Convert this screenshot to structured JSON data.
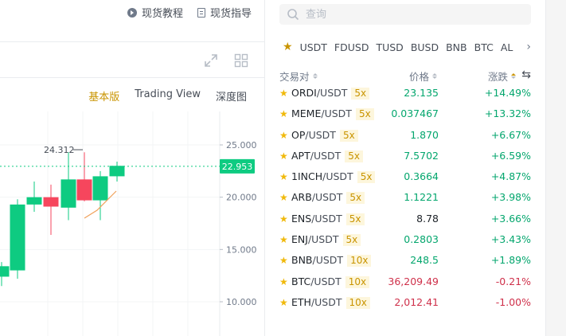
{
  "header": {
    "links": [
      {
        "label": "现货教程",
        "icon": "play-circle-icon"
      },
      {
        "label": "现货指导",
        "icon": "book-icon"
      }
    ]
  },
  "chart_toolbar": {
    "tabs": [
      {
        "label": "基本版",
        "active": true
      },
      {
        "label": "Trading View",
        "active": false
      },
      {
        "label": "深度图",
        "active": false
      }
    ]
  },
  "chart_data": {
    "type": "candlestick",
    "y_ticks": [
      "25.000",
      "20.000",
      "15.000",
      "10.000"
    ],
    "y_tick_values": [
      25,
      20,
      15,
      10
    ],
    "current_price": "22.953",
    "high_annotation": "24.312",
    "candles": [
      {
        "open": 12.4,
        "high": 13.8,
        "low": 11.5,
        "close": 13.4
      },
      {
        "open": 13.0,
        "high": 19.8,
        "low": 12.2,
        "close": 19.3
      },
      {
        "open": 19.3,
        "high": 21.5,
        "low": 18.6,
        "close": 20.0
      },
      {
        "open": 20.0,
        "high": 21.2,
        "low": 16.4,
        "close": 19.1
      },
      {
        "open": 19.0,
        "high": 24.3,
        "low": 17.8,
        "close": 21.7
      },
      {
        "open": 21.7,
        "high": 24.3,
        "low": 19.6,
        "close": 19.7
      },
      {
        "open": 19.7,
        "high": 22.5,
        "low": 17.8,
        "close": 22.0
      },
      {
        "open": 22.0,
        "high": 23.4,
        "low": 21.5,
        "close": 23.0
      }
    ],
    "colors": {
      "up": "#0ecb81",
      "down": "#f6465d",
      "price_tag": "#0ecb81",
      "ma": "#f0a15a"
    }
  },
  "search": {
    "placeholder": "查询"
  },
  "quote_tabs": [
    "USDT",
    "FDUSD",
    "TUSD",
    "BUSD",
    "BNB",
    "BTC",
    "AL"
  ],
  "table": {
    "headers": {
      "pair": "交易对",
      "price": "价格",
      "change": "涨跌"
    },
    "rows": [
      {
        "base": "ORDI",
        "quote": "/USDT",
        "leverage": "5x",
        "price": "23.135",
        "change": "+14.49%",
        "dir": "up"
      },
      {
        "base": "MEME",
        "quote": "/USDT",
        "leverage": "5x",
        "price": "0.037467",
        "change": "+13.32%",
        "dir": "up"
      },
      {
        "base": "OP",
        "quote": "/USDT",
        "leverage": "5x",
        "price": "1.870",
        "change": "+6.67%",
        "dir": "up"
      },
      {
        "base": "APT",
        "quote": "/USDT",
        "leverage": "5x",
        "price": "7.5702",
        "change": "+6.59%",
        "dir": "up"
      },
      {
        "base": "1INCH",
        "quote": "/USDT",
        "leverage": "5x",
        "price": "0.3664",
        "change": "+4.87%",
        "dir": "up"
      },
      {
        "base": "ARB",
        "quote": "/USDT",
        "leverage": "5x",
        "price": "1.1221",
        "change": "+3.98%",
        "dir": "up"
      },
      {
        "base": "ENS",
        "quote": "/USDT",
        "leverage": "5x",
        "price": "8.78",
        "change": "+3.66%",
        "dir": "neutral"
      },
      {
        "base": "ENJ",
        "quote": "/USDT",
        "leverage": "5x",
        "price": "0.2803",
        "change": "+3.43%",
        "dir": "up"
      },
      {
        "base": "BNB",
        "quote": "/USDT",
        "leverage": "10x",
        "price": "248.5",
        "change": "+1.89%",
        "dir": "up"
      },
      {
        "base": "BTC",
        "quote": "/USDT",
        "leverage": "10x",
        "price": "36,209.49",
        "change": "-0.21%",
        "dir": "down"
      },
      {
        "base": "ETH",
        "quote": "/USDT",
        "leverage": "10x",
        "price": "2,012.41",
        "change": "-1.00%",
        "dir": "down"
      }
    ]
  }
}
